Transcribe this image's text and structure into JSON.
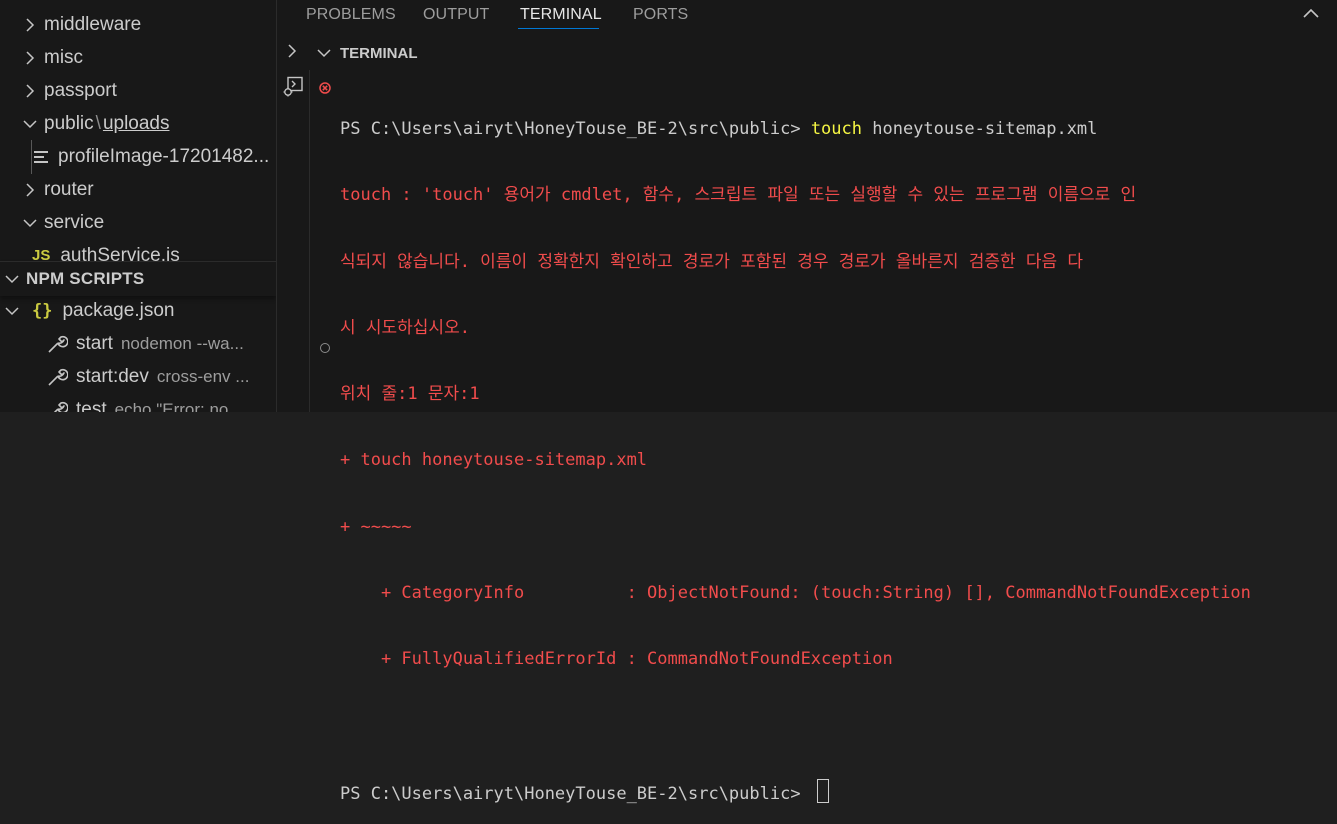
{
  "explorer": {
    "items": [
      {
        "label": "middleware",
        "state": "collapsed"
      },
      {
        "label": "misc",
        "state": "collapsed"
      },
      {
        "label": "passport",
        "state": "collapsed"
      },
      {
        "label": "public",
        "sub": "uploads",
        "state": "expanded"
      },
      {
        "label": "profileImage-17201482...",
        "kind": "file"
      },
      {
        "label": "router",
        "state": "collapsed"
      },
      {
        "label": "service",
        "state": "expanded"
      },
      {
        "label": "authService.js",
        "kind": "js-file"
      }
    ]
  },
  "npm_scripts": {
    "header": "NPM SCRIPTS",
    "package": "package.json",
    "scripts": [
      {
        "name": "start",
        "command": "nodemon --wa..."
      },
      {
        "name": "start:dev",
        "command": "cross-env ..."
      },
      {
        "name": "test",
        "command": "echo \"Error: no..."
      }
    ]
  },
  "panel": {
    "tabs": [
      "PROBLEMS",
      "OUTPUT",
      "TERMINAL",
      "PORTS"
    ],
    "active_tab": "TERMINAL",
    "section_title": "TERMINAL"
  },
  "terminal": {
    "prompt": "PS C:\\Users\\airyt\\HoneyTouse_BE-2\\src\\public> ",
    "command": "touch",
    "args": " honeytouse-sitemap.xml",
    "error_lines": [
      "touch : 'touch' 용어가 cmdlet, 함수, 스크립트 파일 또는 실행할 수 있는 프로그램 이름으로 인",
      "식되지 않습니다. 이름이 정확한지 확인하고 경로가 포함된 경우 경로가 올바른지 검증한 다음 다",
      "시 시도하십시오.",
      "위치 줄:1 문자:1",
      "+ touch honeytouse-sitemap.xml",
      "+ ~~~~~",
      "    + CategoryInfo          : ObjectNotFound: (touch:String) [], CommandNotFoundException",
      "    + FullyQualifiedErrorId : CommandNotFoundException"
    ],
    "prompt2": "PS C:\\Users\\airyt\\HoneyTouse_BE-2\\src\\public> "
  },
  "colors": {
    "error": "#f14c4c",
    "command": "#f5f543",
    "accent": "#0078d4"
  }
}
